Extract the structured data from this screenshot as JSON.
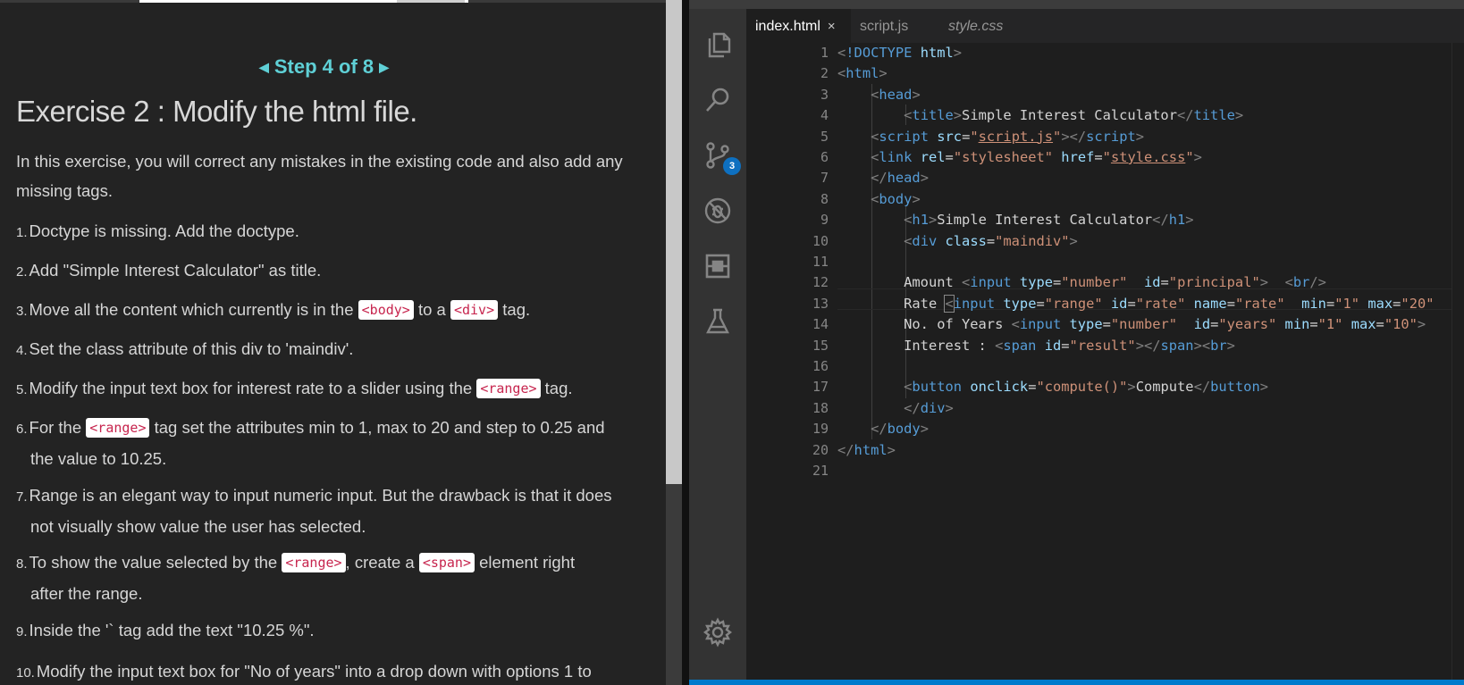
{
  "instructions": {
    "step_label": "Step 4 of 8",
    "title": "Exercise 2 : Modify the html file.",
    "intro": "In this exercise, you will correct any mistakes in the existing code and also add any missing tags.",
    "items": [
      {
        "num": "1.",
        "text": "Doctype is missing. Add the doctype."
      },
      {
        "num": "2.",
        "text": "Add \"Simple Interest Calculator\" as title."
      },
      {
        "num": "3.",
        "pre": "Move all the content which currently is in the ",
        "code1": "<body>",
        "mid": " to a ",
        "code2": "<div>",
        "post": " tag."
      },
      {
        "num": "4.",
        "text": "Set the class attribute of this div to 'maindiv'."
      },
      {
        "num": "5.",
        "pre": "Modify the input text box for interest rate to a slider using the ",
        "code1": "<range>",
        "post": " tag."
      },
      {
        "num": "6.",
        "pre": "For the ",
        "code1": "<range>",
        "post": " tag set the attributes min to 1, max to 20 and step to 0.25 and",
        "line2": "the value to 10.25."
      },
      {
        "num": "7.",
        "text": "Range is an elegant way to input numeric input. But the drawback is that it does",
        "line2": "not visually show value the user has selected."
      },
      {
        "num": "8.",
        "pre": "To show the value selected by the ",
        "code1": "<range>",
        "mid": ", create a ",
        "code2": "<span>",
        "post": " element right",
        "line2": "after the range."
      },
      {
        "num": "9.",
        "text": "Inside the '` tag add the text \"10.25 %\"."
      },
      {
        "num": "10.",
        "text": "Modify the input text box for \"No of years\" into a drop down with options 1 to"
      }
    ]
  },
  "editor": {
    "tabs": [
      {
        "label": "index.html",
        "active": true
      },
      {
        "label": "script.js",
        "active": false
      },
      {
        "label": "style.css",
        "active": false
      }
    ],
    "close_glyph": "×",
    "scm_badge": "3",
    "line_numbers": [
      "1",
      "2",
      "3",
      "4",
      "5",
      "6",
      "7",
      "8",
      "9",
      "10",
      "11",
      "12",
      "13",
      "14",
      "15",
      "16",
      "17",
      "18",
      "19",
      "20",
      "21"
    ],
    "code": {
      "l1_doctype": "!DOCTYPE",
      "l1_html": "html",
      "html": "html",
      "head": "head",
      "title": "title",
      "title_text": "Simple Interest Calculator",
      "script": "script",
      "src": "src",
      "script_js": "script.js",
      "link": "link",
      "rel": "rel",
      "stylesheet": "\"stylesheet\"",
      "href": "href",
      "style_css": "style.css",
      "body": "body",
      "h1": "h1",
      "h1_text": "Simple Interest Calculator",
      "div": "div",
      "class": "class",
      "maindiv": "\"maindiv\"",
      "amount": "Amount ",
      "input": "input",
      "type": "type",
      "number": "\"number\"",
      "id": "id",
      "principal": "\"principal\"",
      "br": "br",
      "rate": "Rate ",
      "range": "\"range\"",
      "rate_id": "\"rate\"",
      "name": "name",
      "rate_name": "\"rate\"",
      "min": "min",
      "min1": "\"1\"",
      "max": "max",
      "max20": "\"20\"",
      "years_label": "No. of Years ",
      "years": "\"years\"",
      "max10": "\"10\"",
      "interest": "Interest : ",
      "span": "span",
      "result": "\"result\"",
      "button": "button",
      "onclick": "onclick",
      "compute_fn": "\"compute()\"",
      "compute": "Compute"
    }
  },
  "colors": {
    "accent": "#5fd0d6",
    "badge": "#0e70c0",
    "statusbar": "#007acc"
  }
}
